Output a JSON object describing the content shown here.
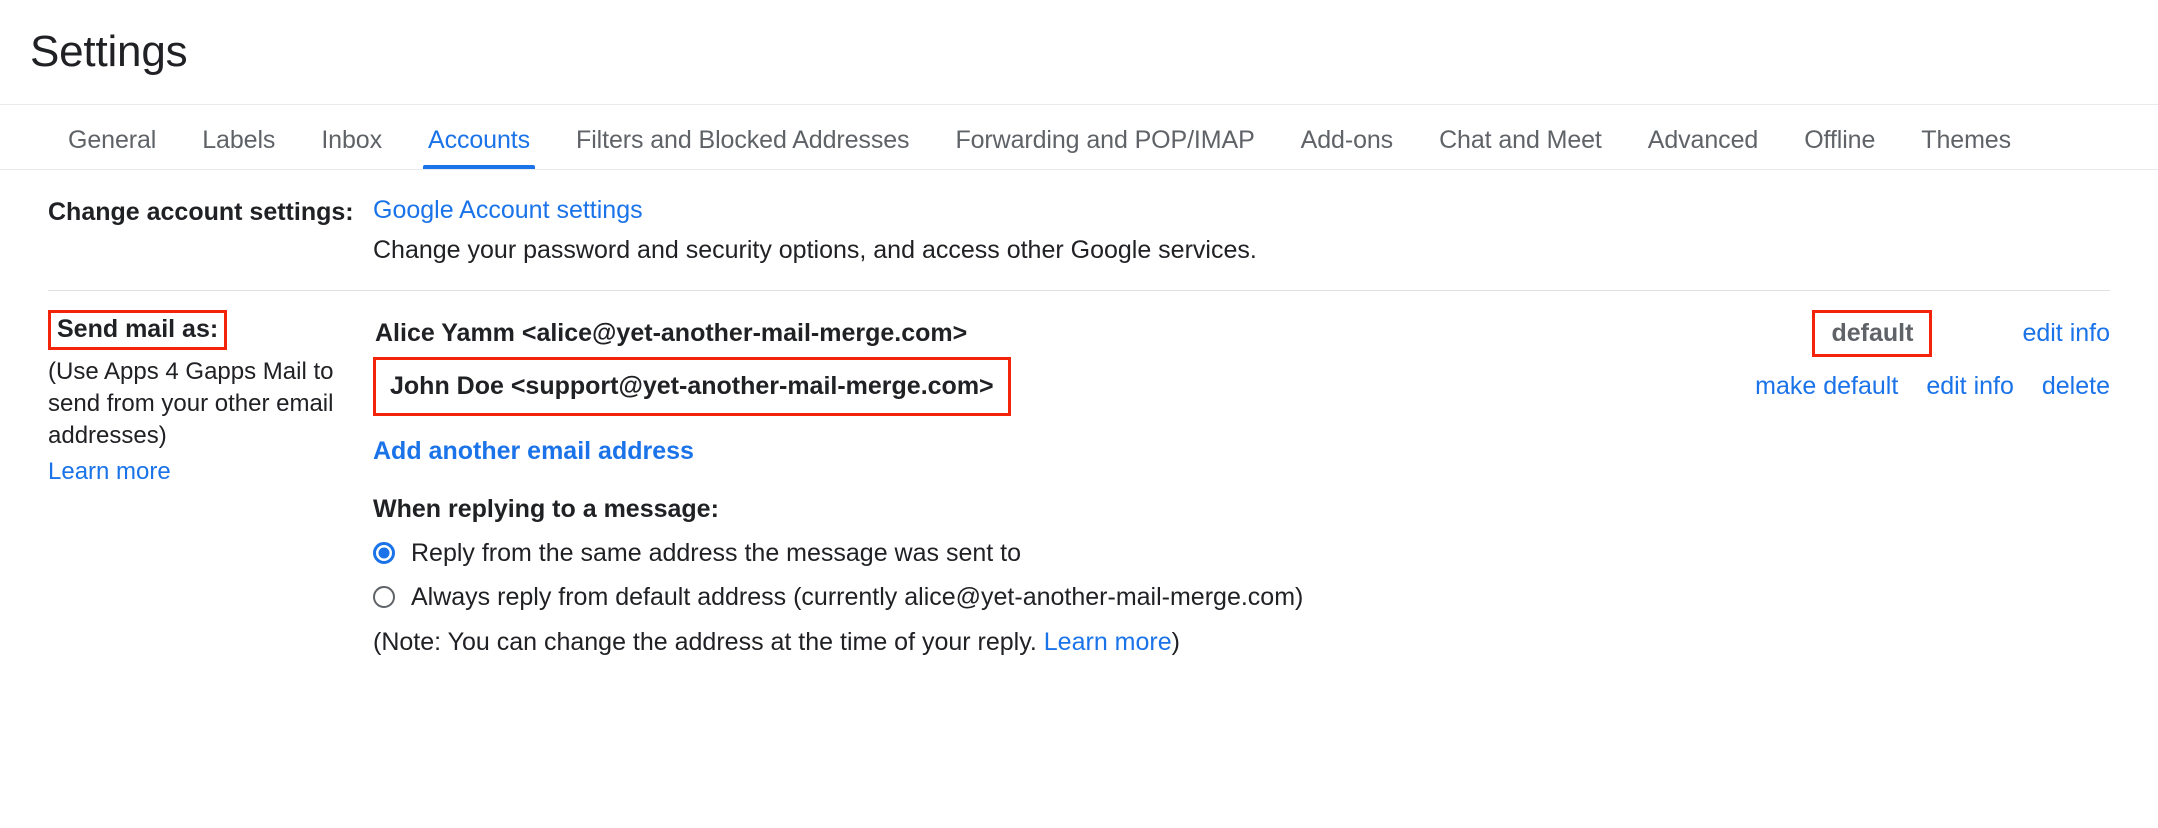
{
  "header": {
    "title": "Settings"
  },
  "tabs": [
    {
      "label": "General",
      "active": false
    },
    {
      "label": "Labels",
      "active": false
    },
    {
      "label": "Inbox",
      "active": false
    },
    {
      "label": "Accounts",
      "active": true
    },
    {
      "label": "Filters and Blocked Addresses",
      "active": false
    },
    {
      "label": "Forwarding and POP/IMAP",
      "active": false
    },
    {
      "label": "Add-ons",
      "active": false
    },
    {
      "label": "Chat and Meet",
      "active": false
    },
    {
      "label": "Advanced",
      "active": false
    },
    {
      "label": "Offline",
      "active": false
    },
    {
      "label": "Themes",
      "active": false
    }
  ],
  "change_account": {
    "label": "Change account settings:",
    "link": "Google Account settings",
    "description": "Change your password and security options, and access other Google services."
  },
  "send_mail_as": {
    "label": "Send mail as:",
    "note": "(Use Apps 4 Gapps Mail to send from your other email addresses)",
    "learn_more": "Learn more",
    "addresses": [
      {
        "name": "Alice Yamm <alice@yet-another-mail-merge.com>",
        "status": "default",
        "actions": [
          "edit info"
        ]
      },
      {
        "name": "John Doe <support@yet-another-mail-merge.com>",
        "status": "",
        "actions": [
          "make default",
          "edit info",
          "delete"
        ]
      }
    ],
    "add_another": "Add another email address",
    "reply_heading": "When replying to a message:",
    "reply_options": [
      {
        "label": "Reply from the same address the message was sent to",
        "selected": true
      },
      {
        "label": "Always reply from default address (currently alice@yet-another-mail-merge.com)",
        "selected": false
      }
    ],
    "note_prefix": "(Note: You can change the address at the time of your reply. ",
    "note_link": "Learn more",
    "note_suffix": ")"
  },
  "colors": {
    "accent_blue": "#1a73e8",
    "highlight_red": "#f4240a",
    "text_primary": "#202124",
    "text_secondary": "#5f6368"
  }
}
